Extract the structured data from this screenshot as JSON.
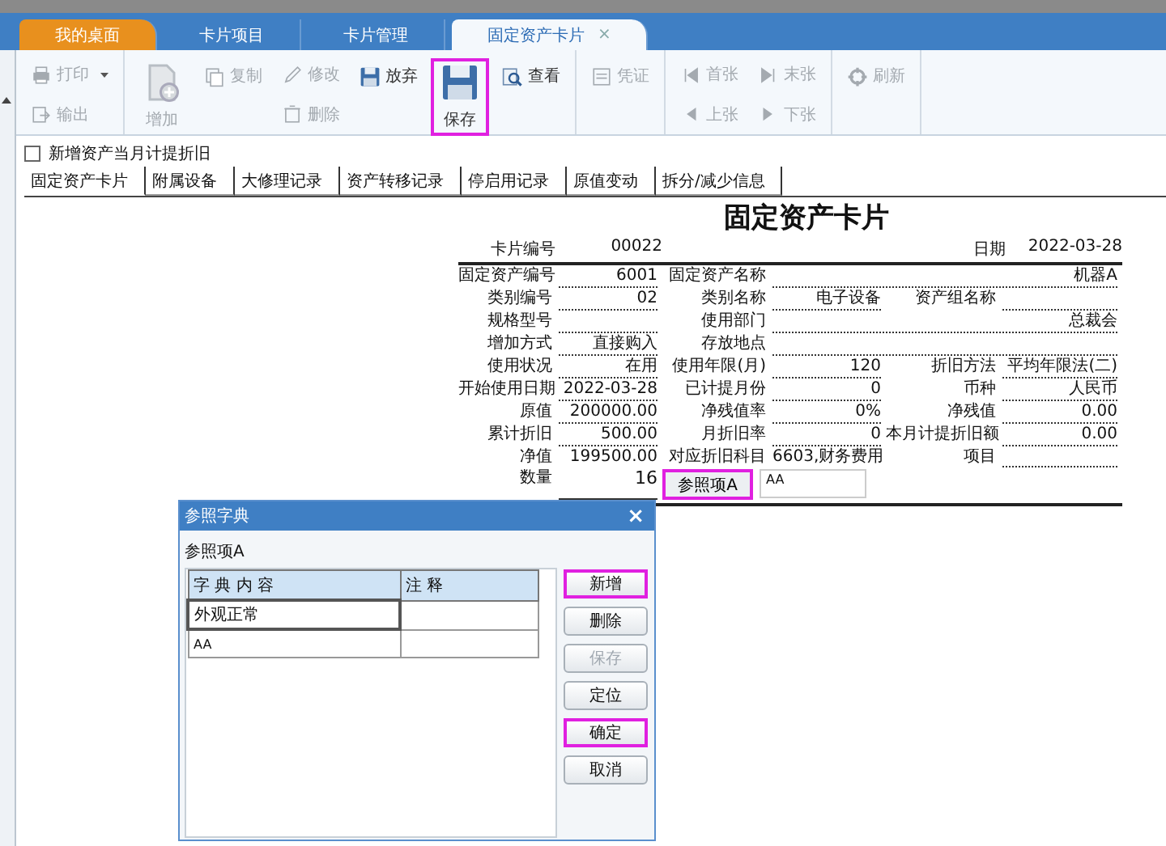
{
  "tabs": [
    {
      "label": "我的桌面",
      "kind": "home",
      "selected": false,
      "closable": false
    },
    {
      "label": "卡片项目",
      "kind": "normal",
      "selected": false,
      "closable": false
    },
    {
      "label": "卡片管理",
      "kind": "normal",
      "selected": false,
      "closable": false
    },
    {
      "label": "固定资产卡片",
      "kind": "normal",
      "selected": true,
      "closable": true,
      "close": "×"
    }
  ],
  "toolbar": {
    "groups": [
      {
        "columns": [
          [
            {
              "label": "打印",
              "kind": "dropdown",
              "disabled": true,
              "highlighted": false
            },
            {
              "label": "输出",
              "kind": "small",
              "disabled": true,
              "highlighted": false
            }
          ]
        ]
      },
      {
        "columns": [
          [
            {
              "label": "增加",
              "kind": "large",
              "disabled": true,
              "highlighted": false
            }
          ],
          [
            {
              "label": "复制",
              "kind": "small",
              "disabled": true,
              "highlighted": false
            }
          ],
          [
            {
              "label": "修改",
              "kind": "small",
              "disabled": true,
              "highlighted": false
            },
            {
              "label": "删除",
              "kind": "small",
              "disabled": true,
              "highlighted": false
            }
          ],
          [
            {
              "label": "放弃",
              "kind": "small",
              "disabled": false,
              "highlighted": false
            }
          ],
          [
            {
              "label": "保存",
              "kind": "large",
              "disabled": false,
              "highlighted": true
            }
          ],
          [
            {
              "label": "查看",
              "kind": "small",
              "disabled": false,
              "highlighted": false
            }
          ]
        ]
      },
      {
        "columns": [
          [
            {
              "label": "凭证",
              "kind": "small",
              "disabled": true,
              "highlighted": false
            }
          ]
        ]
      },
      {
        "columns": [
          [
            {
              "label": "首张",
              "kind": "small",
              "disabled": true,
              "highlighted": false
            },
            {
              "label": "上张",
              "kind": "small",
              "disabled": true,
              "highlighted": false
            }
          ],
          [
            {
              "label": "末张",
              "kind": "small",
              "disabled": true,
              "highlighted": false
            },
            {
              "label": "下张",
              "kind": "small",
              "disabled": true,
              "highlighted": false
            }
          ]
        ]
      },
      {
        "columns": [
          [
            {
              "label": "刷新",
              "kind": "small",
              "disabled": true,
              "highlighted": false
            }
          ]
        ]
      }
    ]
  },
  "option": {
    "label": "新增资产当月计提折旧",
    "checked": false
  },
  "subtabs": [
    {
      "label": "固定资产卡片",
      "selected": true
    },
    {
      "label": "附属设备",
      "selected": false
    },
    {
      "label": "大修理记录",
      "selected": false
    },
    {
      "label": "资产转移记录",
      "selected": false
    },
    {
      "label": "停启用记录",
      "selected": false
    },
    {
      "label": "原值变动",
      "selected": false
    },
    {
      "label": "拆分/减少信息",
      "selected": false
    }
  ],
  "card": {
    "title": "固定资产卡片",
    "header": [
      {
        "label": "卡片编号",
        "value": "00022"
      },
      {
        "label": "日期",
        "value": "2022-03-28"
      }
    ],
    "rows": [
      [
        {
          "label": "固定资产编号",
          "value": "6001",
          "kind": "dotted"
        },
        {
          "label": "固定资产名称",
          "value": "机器A",
          "kind": "dotted"
        }
      ],
      [
        {
          "label": "类别编号",
          "value": "02",
          "kind": "dotted"
        },
        {
          "label": "类别名称",
          "value": "电子设备",
          "kind": "dotted"
        },
        {
          "label": "资产组名称",
          "kind": "dotted"
        }
      ],
      [
        {
          "label": "规格型号",
          "kind": "dotted"
        },
        {
          "label": "使用部门",
          "value": "总裁会",
          "kind": "dotted"
        }
      ],
      [
        {
          "label": "增加方式",
          "value": "直接购入",
          "kind": "dotted"
        },
        {
          "label": "存放地点",
          "kind": "dotted"
        }
      ],
      [
        {
          "label": "使用状况",
          "value": "在用",
          "kind": "dotted"
        },
        {
          "label": "使用年限(月)",
          "value": "120",
          "kind": "dotted"
        },
        {
          "label": "折旧方法",
          "value": "平均年限法(二)",
          "kind": "dotted"
        }
      ],
      [
        {
          "label": "开始使用日期",
          "value": "2022-03-28",
          "kind": "dotted"
        },
        {
          "label": "已计提月份",
          "value": "0",
          "kind": "dotted"
        },
        {
          "label": "币种",
          "value": "人民币",
          "kind": "dotted"
        }
      ],
      [
        {
          "label": "原值",
          "value": "200000.00",
          "kind": "dotted"
        },
        {
          "label": "净残值率",
          "value": "0%",
          "kind": "dotted"
        },
        {
          "label": "净残值",
          "value": "0.00",
          "kind": "dotted"
        }
      ],
      [
        {
          "label": "累计折旧",
          "value": "500.00",
          "kind": "dotted"
        },
        {
          "label": "月折旧率",
          "value": "0",
          "kind": "dotted"
        },
        {
          "label": "本月计提折旧额",
          "value": "0.00",
          "kind": "dotted"
        }
      ],
      [
        {
          "label": "净值",
          "value": "199500.00",
          "kind": "plain"
        },
        {
          "label": "对应折旧科目",
          "value": "6603,财务费用",
          "kind": "plain"
        },
        {
          "label": "项目",
          "kind": "dotted"
        }
      ]
    ],
    "quantity": {
      "label": "数量",
      "value": "16"
    },
    "reference": {
      "label": "参照项A",
      "highlighted": true,
      "value": "AA"
    }
  },
  "dialog": {
    "title": "参照字典",
    "close": "×",
    "caption": "参照项A",
    "columns": [
      "字 典 内 容",
      "注 释"
    ],
    "rows": [
      {
        "cells": [
          "外观正常"
        ],
        "selected": true
      },
      {
        "cells": [
          "AA"
        ],
        "selected": false
      }
    ],
    "buttons": [
      {
        "label": "新增",
        "disabled": false,
        "highlighted": true
      },
      {
        "label": "删除",
        "disabled": false,
        "highlighted": false
      },
      {
        "label": "保存",
        "disabled": true,
        "highlighted": false
      },
      {
        "label": "定位",
        "disabled": false,
        "highlighted": false
      },
      {
        "label": "确定",
        "disabled": false,
        "highlighted": true
      },
      {
        "label": "取消",
        "disabled": false,
        "highlighted": false
      }
    ]
  }
}
